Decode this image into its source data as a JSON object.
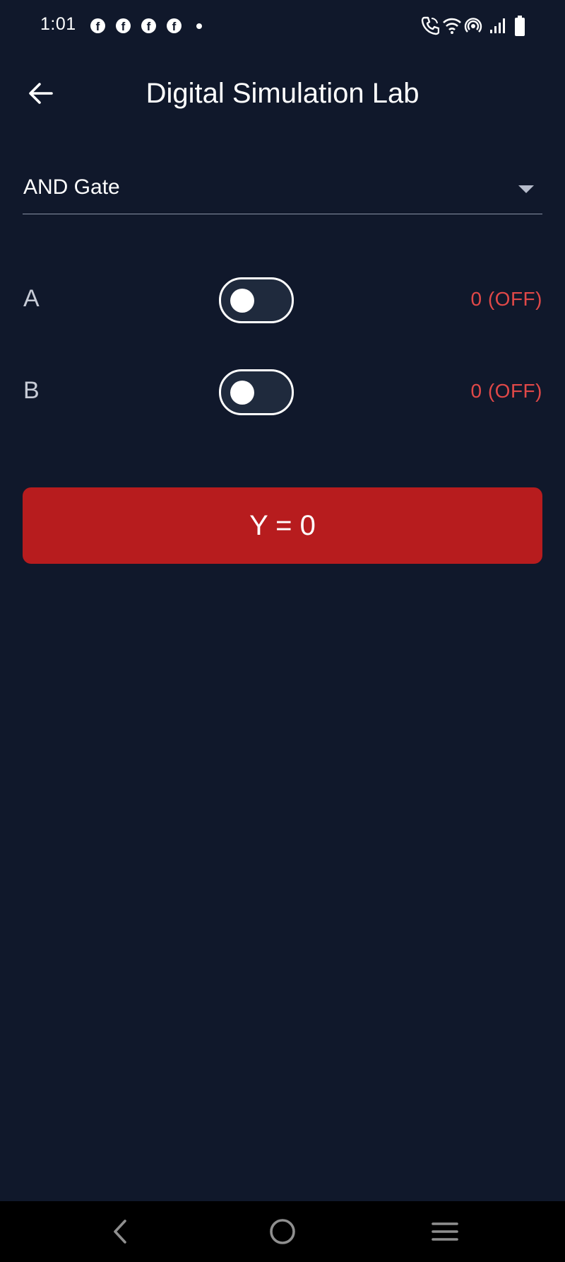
{
  "status_bar": {
    "time": "1:01",
    "notification_icons": [
      "facebook-icon",
      "facebook-icon",
      "facebook-icon",
      "facebook-icon",
      "dot-icon"
    ],
    "system_icons": [
      "wifi-call-icon",
      "wifi-icon",
      "hotspot-icon",
      "signal-icon",
      "battery-icon"
    ]
  },
  "app_bar": {
    "title": "Digital Simulation Lab",
    "back_icon": "arrow-left-icon"
  },
  "gate_select": {
    "selected": "AND Gate",
    "icon": "caret-down-icon"
  },
  "inputs": [
    {
      "label": "A",
      "on": false,
      "status": "0 (OFF)"
    },
    {
      "label": "B",
      "on": false,
      "status": "0 (OFF)"
    }
  ],
  "output": {
    "text": "Y = 0"
  },
  "colors": {
    "background": "#10182b",
    "off_text": "#e04848",
    "output_off": "#b71c1e",
    "toggle_track": "#1f2a3d"
  },
  "nav_bar": {
    "icons": [
      "chevron-left-icon",
      "circle-home-icon",
      "menu-lines-icon"
    ]
  }
}
